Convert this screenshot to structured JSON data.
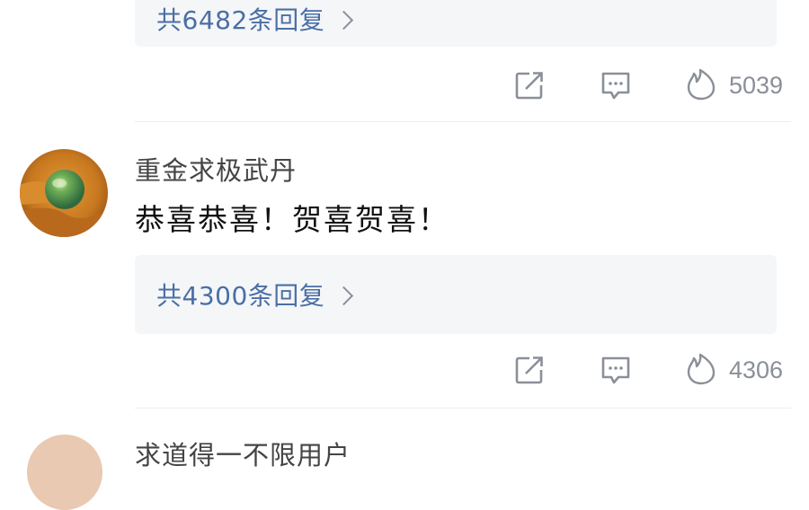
{
  "comments": [
    {
      "reply_summary": "共6482条回复",
      "likes": "5039",
      "icons": [
        "share-icon",
        "comment-icon",
        "like-flame-icon"
      ]
    },
    {
      "username": "重金求极武丹",
      "text": "恭喜恭喜！贺喜贺喜！",
      "reply_summary": "共4300条回复",
      "likes": "4306",
      "icons": [
        "share-icon",
        "comment-icon",
        "like-flame-icon"
      ]
    },
    {
      "username": "求道得一不限用户"
    }
  ],
  "colors": {
    "link": "#4a6fa5",
    "reply_bg": "#f5f6f8",
    "icon": "#8a8f98"
  }
}
